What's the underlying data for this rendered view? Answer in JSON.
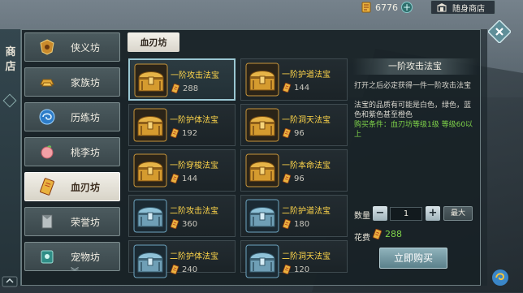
{
  "topbar": {
    "currency_amount": "6776",
    "currency_icon": "coupon-icon",
    "add_icon": "plus-icon",
    "store_label": "随身商店",
    "store_icon": "shop-icon"
  },
  "side": {
    "title": "商店"
  },
  "categories": [
    {
      "label": "侠义坊",
      "icon": "shield-badge-icon"
    },
    {
      "label": "家族坊",
      "icon": "gold-ingot-icon"
    },
    {
      "label": "历练坊",
      "icon": "blue-swirl-icon"
    },
    {
      "label": "桃李坊",
      "icon": "peach-icon"
    },
    {
      "label": "血刃坊",
      "icon": "coupon-icon",
      "active": true
    },
    {
      "label": "荣誉坊",
      "icon": "banner-icon"
    },
    {
      "label": "宠物坊",
      "icon": "pet-scroll-icon"
    }
  ],
  "subtab": "血刃坊",
  "items": [
    {
      "name": "一阶攻击法宝",
      "price": "288",
      "tier": "gold",
      "selected": true
    },
    {
      "name": "一阶护道法宝",
      "price": "144",
      "tier": "gold"
    },
    {
      "name": "一阶护体法宝",
      "price": "192",
      "tier": "gold"
    },
    {
      "name": "一阶洞天法宝",
      "price": "96",
      "tier": "gold"
    },
    {
      "name": "一阶穿梭法宝",
      "price": "144",
      "tier": "gold"
    },
    {
      "name": "一阶本命法宝",
      "price": "96",
      "tier": "gold"
    },
    {
      "name": "二阶攻击法宝",
      "price": "360",
      "tier": "silver"
    },
    {
      "name": "二阶护道法宝",
      "price": "180",
      "tier": "silver"
    },
    {
      "name": "二阶护体法宝",
      "price": "240",
      "tier": "silver"
    },
    {
      "name": "二阶洞天法宝",
      "price": "120",
      "tier": "silver"
    }
  ],
  "detail": {
    "title": "一阶攻击法宝",
    "desc1": "打开之后必定获得一件一阶攻击法宝",
    "desc2": "法宝的品质有可能是白色，绿色，蓝色和紫色甚至橙色",
    "requirement": "购买条件：血刃坊等级1级 等级60以上",
    "qty_label": "数量",
    "qty_value": "1",
    "max_label": "最大",
    "cost_label": "花费",
    "cost_value": "288",
    "buy_label": "立即购买"
  },
  "colors": {
    "item_name": "#ffd64a",
    "requirement": "#7fd44a",
    "gold_chest": "#d8a233",
    "silver_chest": "#7fb6cf"
  }
}
